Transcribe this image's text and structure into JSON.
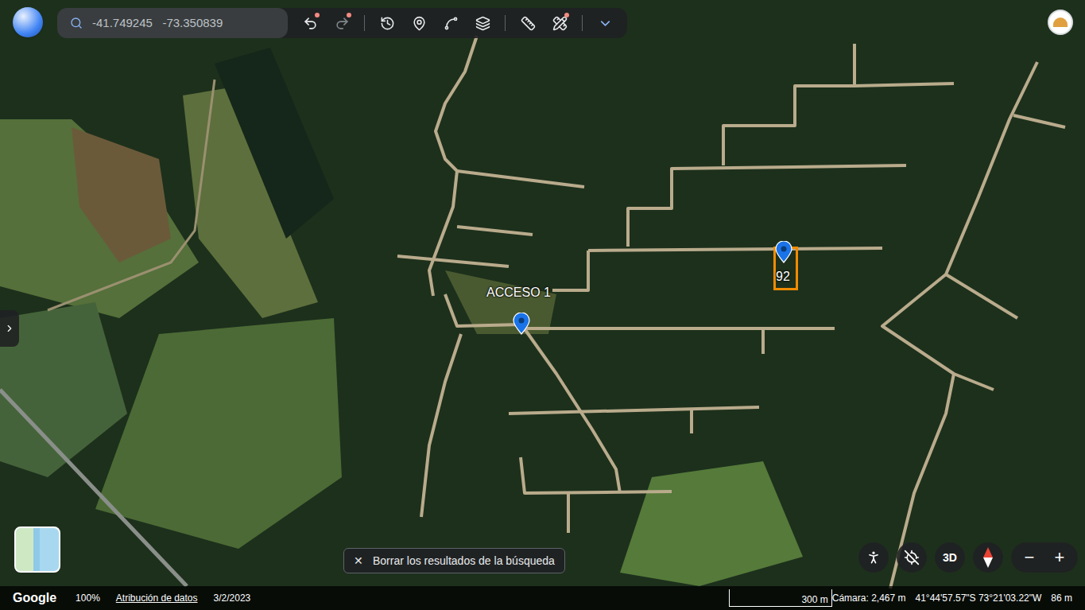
{
  "search": {
    "value": "-41.749245   -73.350839"
  },
  "toolbar": [
    {
      "badge": true,
      "disabled": false
    },
    {
      "badge": true,
      "disabled": true
    },
    {
      "badge": false,
      "disabled": false
    },
    {
      "badge": false,
      "disabled": false
    },
    {
      "badge": false,
      "disabled": false
    },
    {
      "badge": false,
      "disabled": false
    },
    {
      "badge": false,
      "disabled": false
    },
    {
      "badge": true,
      "disabled": false
    },
    {
      "badge": false,
      "disabled": false
    }
  ],
  "placemarks": [
    {
      "label": "ACCESO 1",
      "highlighted": false,
      "color": "#1a73e8"
    },
    {
      "label": "92",
      "highlighted": true,
      "color": "#f28b00"
    }
  ],
  "search_results": {
    "close": "✕",
    "label": "Borrar los resultados de la búsqueda"
  },
  "map_controls": {
    "view_mode": "3D",
    "zoom_out": "−",
    "zoom_in": "+"
  },
  "status_bar": {
    "brand": "Google",
    "zoom": "100%",
    "attribution": "Atribución de datos",
    "imagery_date": "3/2/2023",
    "scale": "300 m",
    "camera": "Cámara: 2,467 m",
    "coordinates": "41°44'57.57\"S 73°21'03.22\"W",
    "elevation": "86 m"
  }
}
